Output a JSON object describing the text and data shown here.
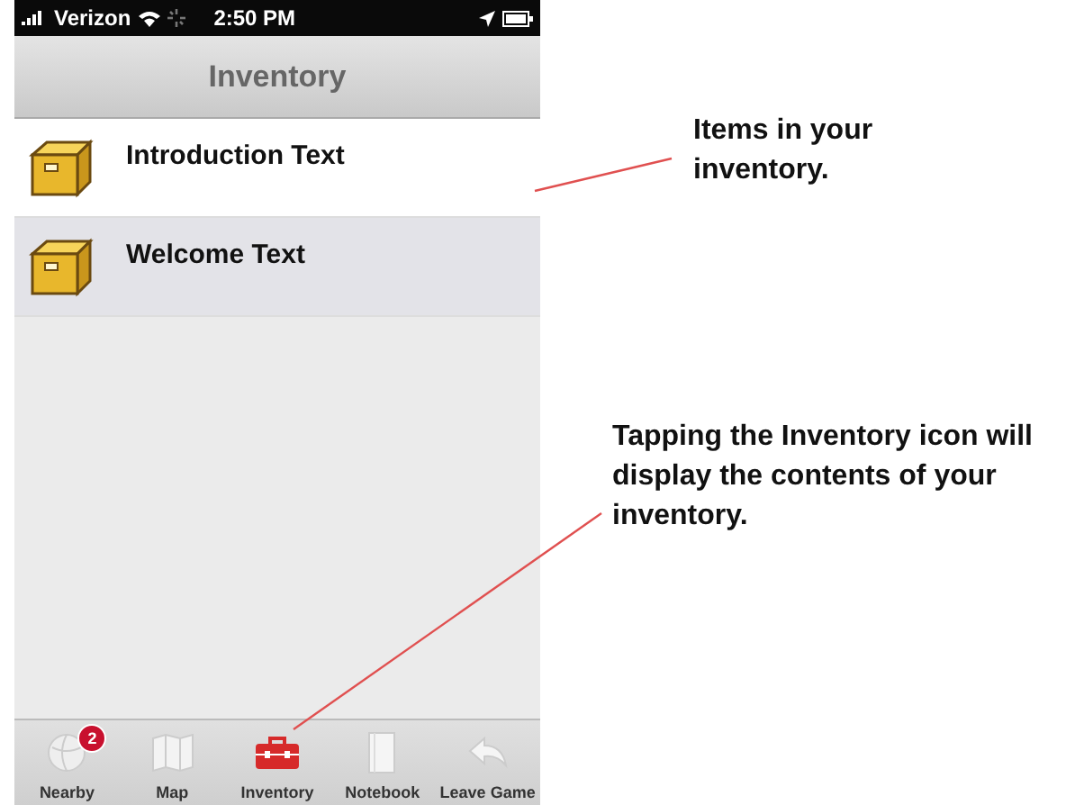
{
  "status_bar": {
    "carrier": "Verizon",
    "time": "2:50 PM"
  },
  "nav_bar": {
    "title": "Inventory"
  },
  "items": [
    {
      "label": "Introduction Text",
      "selected": false
    },
    {
      "label": "Welcome Text",
      "selected": true
    }
  ],
  "tab_bar": [
    {
      "label": "Nearby",
      "badge": "2",
      "selected": false
    },
    {
      "label": "Map",
      "selected": false
    },
    {
      "label": "Inventory",
      "selected": true
    },
    {
      "label": "Notebook",
      "selected": false
    },
    {
      "label": "Leave Game",
      "selected": false
    }
  ],
  "annotations": [
    "Items in your inventory.",
    "Tapping the Inventory icon will display the contents of your inventory."
  ]
}
